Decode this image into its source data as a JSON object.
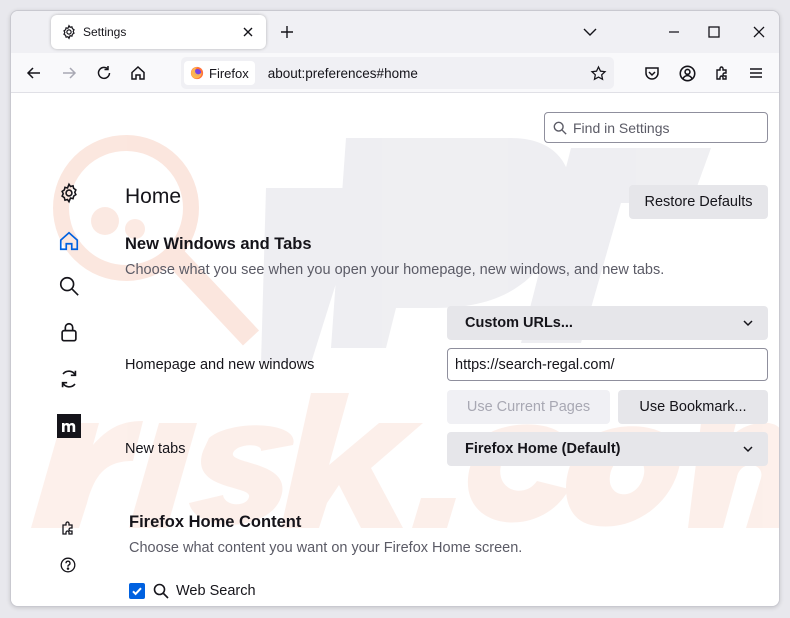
{
  "tab": {
    "title": "Settings"
  },
  "urlbar": {
    "identity_label": "Firefox",
    "url": "about:preferences#home"
  },
  "search": {
    "placeholder": "Find in Settings"
  },
  "main": {
    "title": "Home",
    "restore_label": "Restore Defaults",
    "windows_section": {
      "heading": "New Windows and Tabs",
      "description": "Choose what you see when you open your homepage, new windows, and new tabs."
    },
    "homepage": {
      "label": "Homepage and new windows",
      "mode": "Custom URLs...",
      "url_value": "https://search-regal.com/",
      "use_current_label": "Use Current Pages",
      "use_bookmark_label": "Use Bookmark..."
    },
    "newtabs": {
      "label": "New tabs",
      "value": "Firefox Home (Default)"
    },
    "home_content": {
      "heading": "Firefox Home Content",
      "description": "Choose what content you want on your Firefox Home screen.",
      "web_search_label": "Web Search",
      "web_search_checked": true
    }
  },
  "sidebar": {
    "items": [
      "gear-icon",
      "home-icon",
      "search-icon",
      "lock-icon",
      "sync-icon",
      "mozilla-m-icon"
    ],
    "footer": [
      "extensions-icon",
      "help-icon"
    ]
  },
  "colors": {
    "accent": "#0061e0",
    "watermark": "#f4b9a3"
  }
}
